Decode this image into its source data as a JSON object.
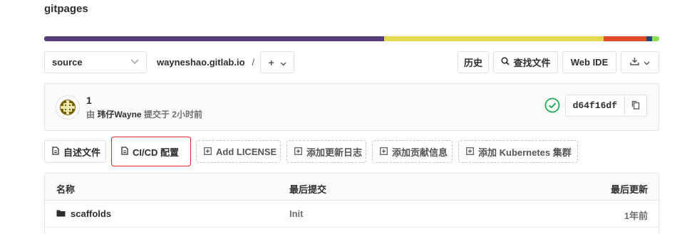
{
  "project": {
    "title": "gitpages"
  },
  "language_bar": {
    "segments": [
      {
        "color": "#563d7c",
        "percent": 52.2
      },
      {
        "color": "#e4d84c",
        "percent": 38.1
      },
      {
        "color": "#e34c26",
        "percent": 7.5
      },
      {
        "color": "#244776",
        "percent": 1.0
      },
      {
        "color": "#89e051",
        "percent": 1.2
      }
    ]
  },
  "tree": {
    "branch": "source",
    "path": "wayneshao.gitlab.io",
    "separator": "/",
    "add_label": "+",
    "history_label": "历史",
    "find_file_label": "查找文件",
    "web_ide_label": "Web IDE",
    "download_icon": "download-icon"
  },
  "commit": {
    "message": "1",
    "by": "由",
    "author": "玮仔Wayne",
    "committed": "提交于",
    "time": "2小时前",
    "sha": "d64f16df",
    "status_color": "#1aaa55"
  },
  "quick_links": [
    {
      "label": "自述文件",
      "style": "solid"
    },
    {
      "label": "CI/CD 配置",
      "style": "solid-highlight"
    },
    {
      "label": "Add LICENSE",
      "style": "dashed"
    },
    {
      "label": "添加更新日志",
      "style": "dashed"
    },
    {
      "label": "添加贡献信息",
      "style": "dashed"
    },
    {
      "label": "添加 Kubernetes 集群",
      "style": "dashed"
    }
  ],
  "files": {
    "headers": {
      "name": "名称",
      "last_commit": "最后提交",
      "last_update": "最后更新"
    },
    "rows": [
      {
        "name": "scaffolds",
        "commit": "Init",
        "updated": "1年前"
      }
    ]
  }
}
